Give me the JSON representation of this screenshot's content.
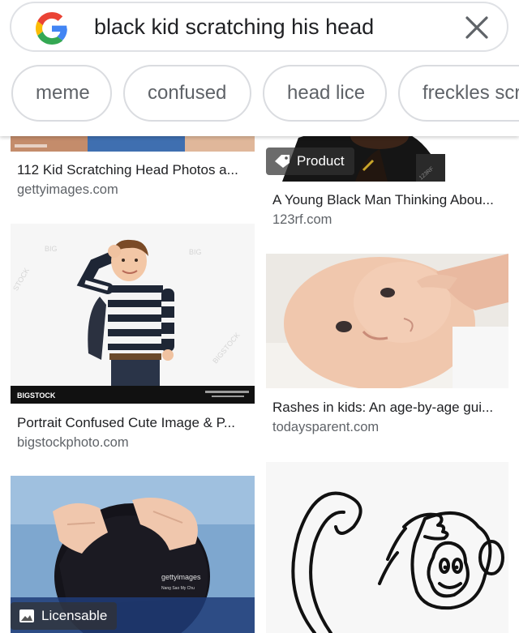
{
  "search": {
    "query": "black kid scratching his head",
    "logo_icon": "google-g-icon",
    "clear_icon": "close-icon"
  },
  "chips": [
    {
      "label": "meme"
    },
    {
      "label": "confused"
    },
    {
      "label": "head lice"
    },
    {
      "label": "freckles scr"
    }
  ],
  "results": [
    {
      "title": "112 Kid Scratching Head Photos a...",
      "source": "gettyimages.com"
    },
    {
      "title": "A Young Black Man Thinking Abou...",
      "source": "123rf.com",
      "badge": "Product"
    },
    {
      "title": "Portrait Confused Cute Image & P...",
      "source": "bigstockphoto.com",
      "brand": "BIGSTOCK"
    },
    {
      "title": "Rashes in kids: An age-by-age gui...",
      "source": "todaysparent.com"
    },
    {
      "badge": "Licensable",
      "watermark": "gettyimages"
    },
    {}
  ],
  "colors": {
    "google_blue": "#4285F4",
    "google_red": "#EA4335",
    "google_yellow": "#FBBC05",
    "google_green": "#34A853"
  }
}
